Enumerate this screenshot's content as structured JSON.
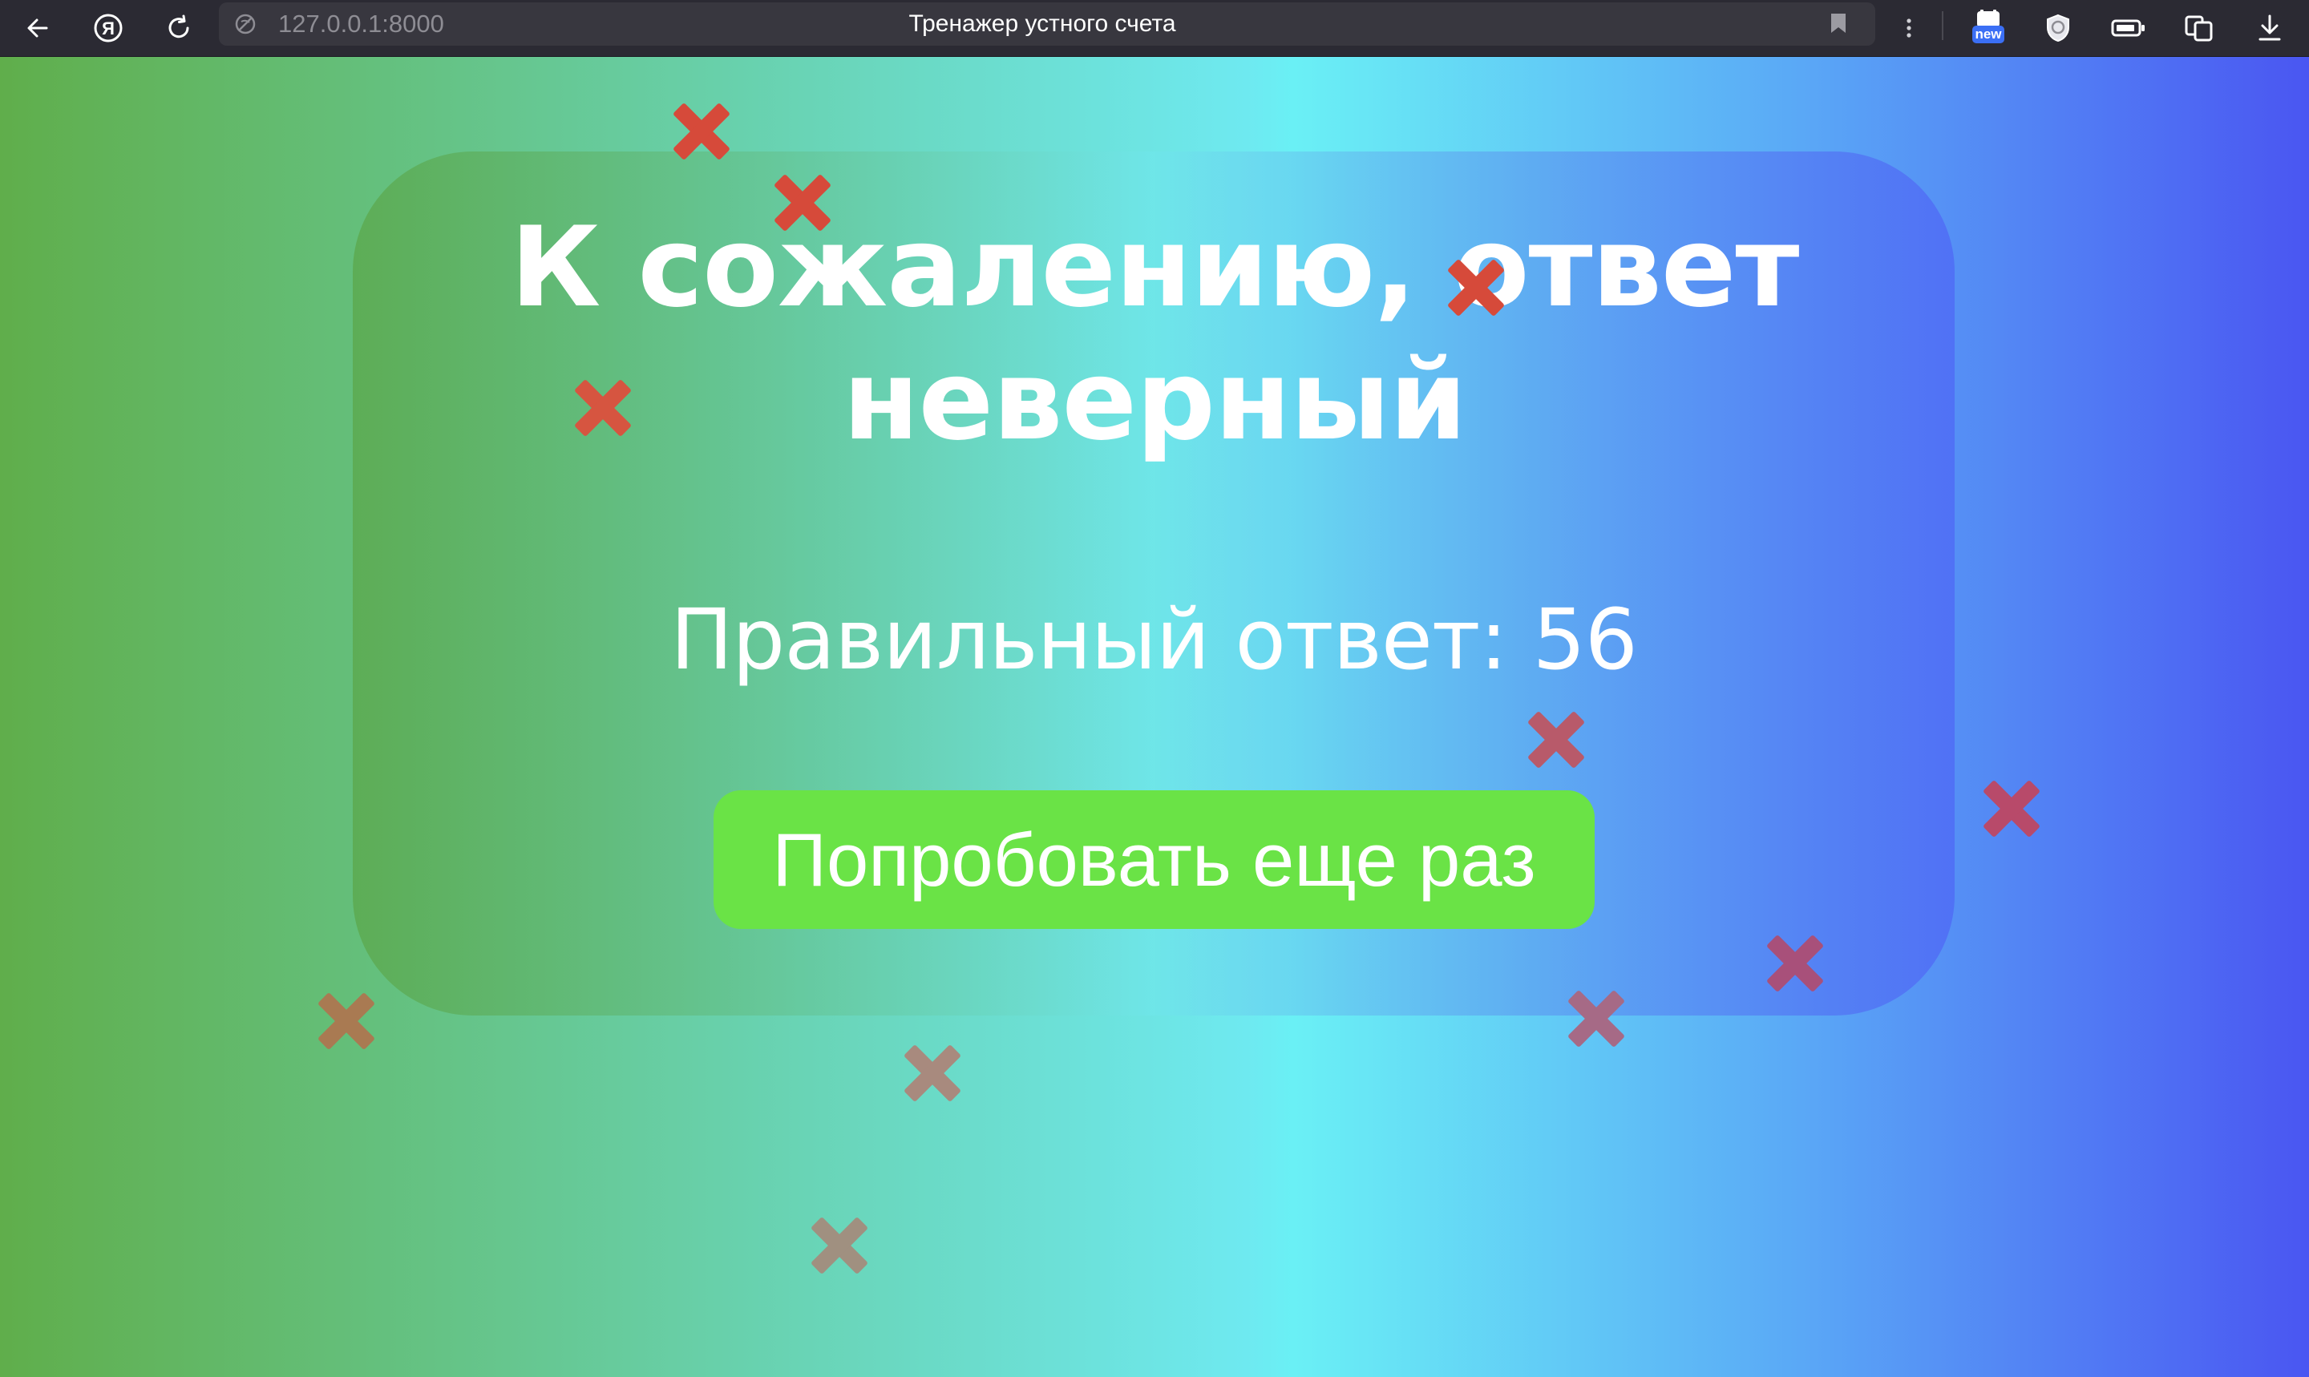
{
  "browser": {
    "url": "127.0.0.1:8000",
    "tab_title": "Тренажер устного счета",
    "extension_badge": "new"
  },
  "main": {
    "heading_line1": "К сожалению, ответ",
    "heading_line2": "неверный",
    "correct_answer_text": "Правильный ответ: 56",
    "retry_button_label": "Попробовать еще раз"
  },
  "colors": {
    "button_background": "#6ae346",
    "cross_red": "#d94b3d",
    "cross_muted": "#a58a7a",
    "gradient_left": "#60ae4b",
    "gradient_center": "#6ef0f5",
    "gradient_right": "#4a56f2"
  },
  "decorations": {
    "cross_icon_count": 12
  }
}
